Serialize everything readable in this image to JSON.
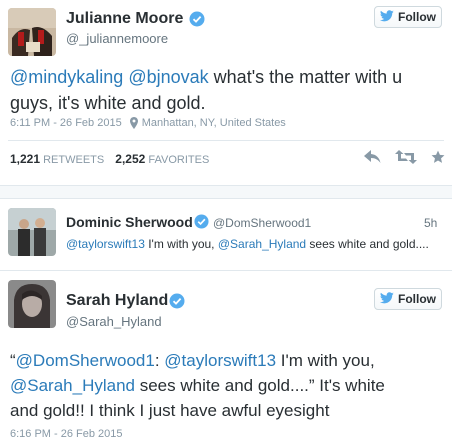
{
  "tweet1": {
    "name": "Julianne Moore",
    "handle": "@_juliannemoore",
    "follow_label": "Follow",
    "mention1": "@mindykaling",
    "mention2": "@bjnovak",
    "text_rest_line1": " what's the matter with u",
    "text_line2": "guys, it's white and gold.",
    "timestamp": "6:11 PM - 26 Feb 2015",
    "location": "Manhattan, NY, United States",
    "retweets_count": "1,221",
    "retweets_label": "RETWEETS",
    "favorites_count": "2,252",
    "favorites_label": "FAVORITES"
  },
  "tweet2": {
    "name": "Dominic Sherwood",
    "handle": "@DomSherwood1",
    "time_ago": "5h",
    "mention1": "@taylorswift13",
    "text_mid": " I'm with you, ",
    "mention2": "@Sarah_Hyland",
    "text_end": " sees white and gold...."
  },
  "tweet3": {
    "name": "Sarah Hyland",
    "handle": "@Sarah_Hyland",
    "follow_label": "Follow",
    "quote_open": "“",
    "mention1": "@DomSherwood1",
    "colon": ": ",
    "mention2": "@taylorswift13",
    "text_a": " I'm with you,",
    "mention3": "@Sarah_Hyland",
    "text_b": " sees white and gold....” It's white",
    "text_c": "and gold!! I think I just have awful eyesight",
    "timestamp": "6:16 PM - 26 Feb 2015"
  },
  "colors": {
    "link": "#2b7bb9",
    "verified": "#55acee",
    "muted": "#8899a6",
    "twitter_bird": "#55acee"
  },
  "icons": {
    "verified": "verified-badge-icon",
    "bird": "twitter-bird-icon",
    "location": "location-pin-icon",
    "reply": "reply-icon",
    "retweet": "retweet-icon",
    "favorite": "star-icon"
  }
}
